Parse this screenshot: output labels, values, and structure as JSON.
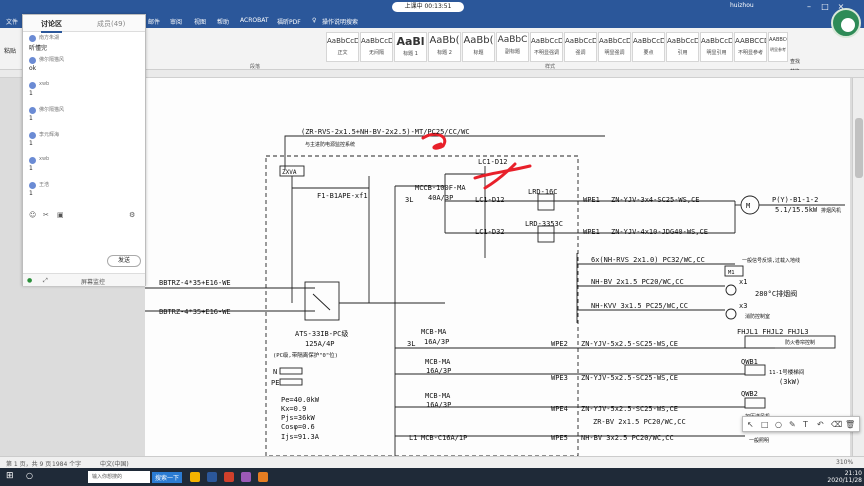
{
  "window": {
    "title": "—",
    "user": "huizhou",
    "meeting_status": "上课中 00:13:51"
  },
  "ribbon_tabs": [
    "文件",
    "",
    "",
    "",
    "",
    "",
    "",
    "",
    "邮件",
    "审阅",
    "视图",
    "帮助",
    "ACROBAT",
    "福昕PDF",
    "操作说明搜索"
  ],
  "ribbon": {
    "paste_label": "粘贴",
    "paragraph_label": "段落",
    "styles_label": "样式",
    "styles": [
      {
        "sample": "AaBbCcDi",
        "name": "正文"
      },
      {
        "sample": "AaBbCcDi",
        "name": "无间隔"
      },
      {
        "sample": "AaBl",
        "name": "标题 1"
      },
      {
        "sample": "AaBb(",
        "name": "标题 2"
      },
      {
        "sample": "AaBb(",
        "name": "标题"
      },
      {
        "sample": "AaBbC",
        "name": "副标题"
      },
      {
        "sample": "AaBbCcDi",
        "name": "不明显强调"
      },
      {
        "sample": "AaBbCcDi",
        "name": "强调"
      },
      {
        "sample": "AaBbCcDi",
        "name": "明显强调"
      },
      {
        "sample": "AaBbCcDi",
        "name": "要点"
      },
      {
        "sample": "AaBbCcDi",
        "name": "引用"
      },
      {
        "sample": "AaBbCcDi",
        "name": "明显引用"
      },
      {
        "sample": "AABBCCDI",
        "name": "不明显参考"
      },
      {
        "sample": "AABBCCDI",
        "name": "明显参考"
      }
    ],
    "edit": {
      "find": "查找",
      "replace": "替换",
      "select": "选择"
    }
  },
  "chat_panel": {
    "tab_discussion": "讨论区",
    "tab_members": "成员(49)",
    "messages": [
      {
        "name": "南方朱湖",
        "text": "听懂完"
      },
      {
        "name": "佛尔隔猫风",
        "text": "ok"
      },
      {
        "name": "xwb",
        "text": "1"
      },
      {
        "name": "佛尔隔猫风",
        "text": "1"
      },
      {
        "name": "李元辉海",
        "text": "1"
      },
      {
        "name": "xwb",
        "text": "1"
      },
      {
        "name": "王浩",
        "text": "1"
      },
      {
        "name": "xwb",
        "text": "1"
      }
    ],
    "send_label": "发送",
    "bottom_label": "屏幕监控"
  },
  "drawing": {
    "top_cable": "(ZR-RVS-2x1.5+NH-BV-2x2.5)-MT/PC25/CC/WC",
    "top_note": "与主进防电源监控系统",
    "zxva": "ZXVA",
    "f1": "F1-B1APE-xf1",
    "incoming1": "BBTRZ-4*35+E16-WE",
    "incoming2": "BBTRZ-4*35+E16-WE",
    "ats": "ATS-33IB-PC级",
    "ats_rating": "125A/4P",
    "ats_note": "(PC级,带隔离保护\"0\"位)",
    "n": "N",
    "pe": "PE",
    "pe_val": "Pe=40.0kW",
    "kx": "Kx=0.9",
    "pjs": "Pjs=36kW",
    "cos": "Cosφ=0.6",
    "ijs": "Ijs=91.3A",
    "mccb": "MCCB-100F-MA",
    "mccb_rating": "40A/3P",
    "three_l": "3L",
    "lc1_d12a": "LC1-D12",
    "lc1_d12b": "LC1-D12",
    "lc1_d32": "LC1-D32",
    "lrd16": "LRD-16C",
    "lrd3353": "LRD-3353C",
    "wpe1a": "WPE1",
    "wpe1b": "WPE1",
    "cable1": "ZN-YJV-3x4-SC25-WS,CE",
    "cable2": "ZN-YJV-4x10-JDG40-WS,CE",
    "motor": "M",
    "motor_label": "P(Y)-B1-1-2",
    "motor_power": "5.1/15.5kW",
    "motor_note": "排烟风机",
    "ctrl1": "6x(NH-RVS 2x1.0) PC32/WC,CC",
    "ctrl1_note": "一般信号反馈,过载入地线",
    "m1": "M1",
    "ctrl2": "NH-BV 2x1.5 PC20/WC,CC",
    "x1": "x1",
    "temp": "280°C排烟阀",
    "ctrl3": "NH-KVV 3x1.5 PC25/WC,CC",
    "x3": "x3",
    "ctrl3_note": "消防控制室",
    "mcb1": "MCB-MA",
    "mcb1_r": "16A/3P",
    "mcb2": "MCB-MA",
    "mcb2_r": "16A/3P",
    "mcb3": "MCB-MA",
    "mcb3_r": "16A/3P",
    "mcb4": "MCB-C16A/1P",
    "l1": "L1",
    "wpe2": "WPE2",
    "wpe3": "WPE3",
    "wpe4": "WPE4",
    "wpe5": "WPE5",
    "c_wpe2": "ZN-YJV-5x2.5-SC25-WS,CE",
    "c_wpe3": "ZN-YJV-5x2.5-SC25-WS,CE",
    "c_wpe4": "ZN-YJV-5x2.5-SC25-WS,CE",
    "c_wpe4b": "ZR-BV 2x1.5 PC20/WC,CC",
    "c_wpe5": "NH-BV 3x2.5 PC20/WC,CC",
    "fhjl": "FHJL1 FHJL2 FHJL3",
    "fhjl_note": "防火卷帘控制",
    "qwb1": "QWB1",
    "qwb1_note": "11-1号楼梯间",
    "qwb1_power": "(3kW)",
    "qwb2": "QWB2",
    "qwb2_note": "加压送风机",
    "last_note": "一般照明"
  },
  "status": {
    "page": "第 1 页，共 9 页",
    "words": "1984 个字",
    "lang": "中文(中国)",
    "zoom": "310%"
  },
  "taskbar": {
    "search_placeholder": "输入你想搜的",
    "search_btn": "搜索一下",
    "time": "21:10",
    "date": "2020/11/28"
  },
  "colors": {
    "word_blue": "#2b579a",
    "annotation_red": "#e8202a"
  }
}
